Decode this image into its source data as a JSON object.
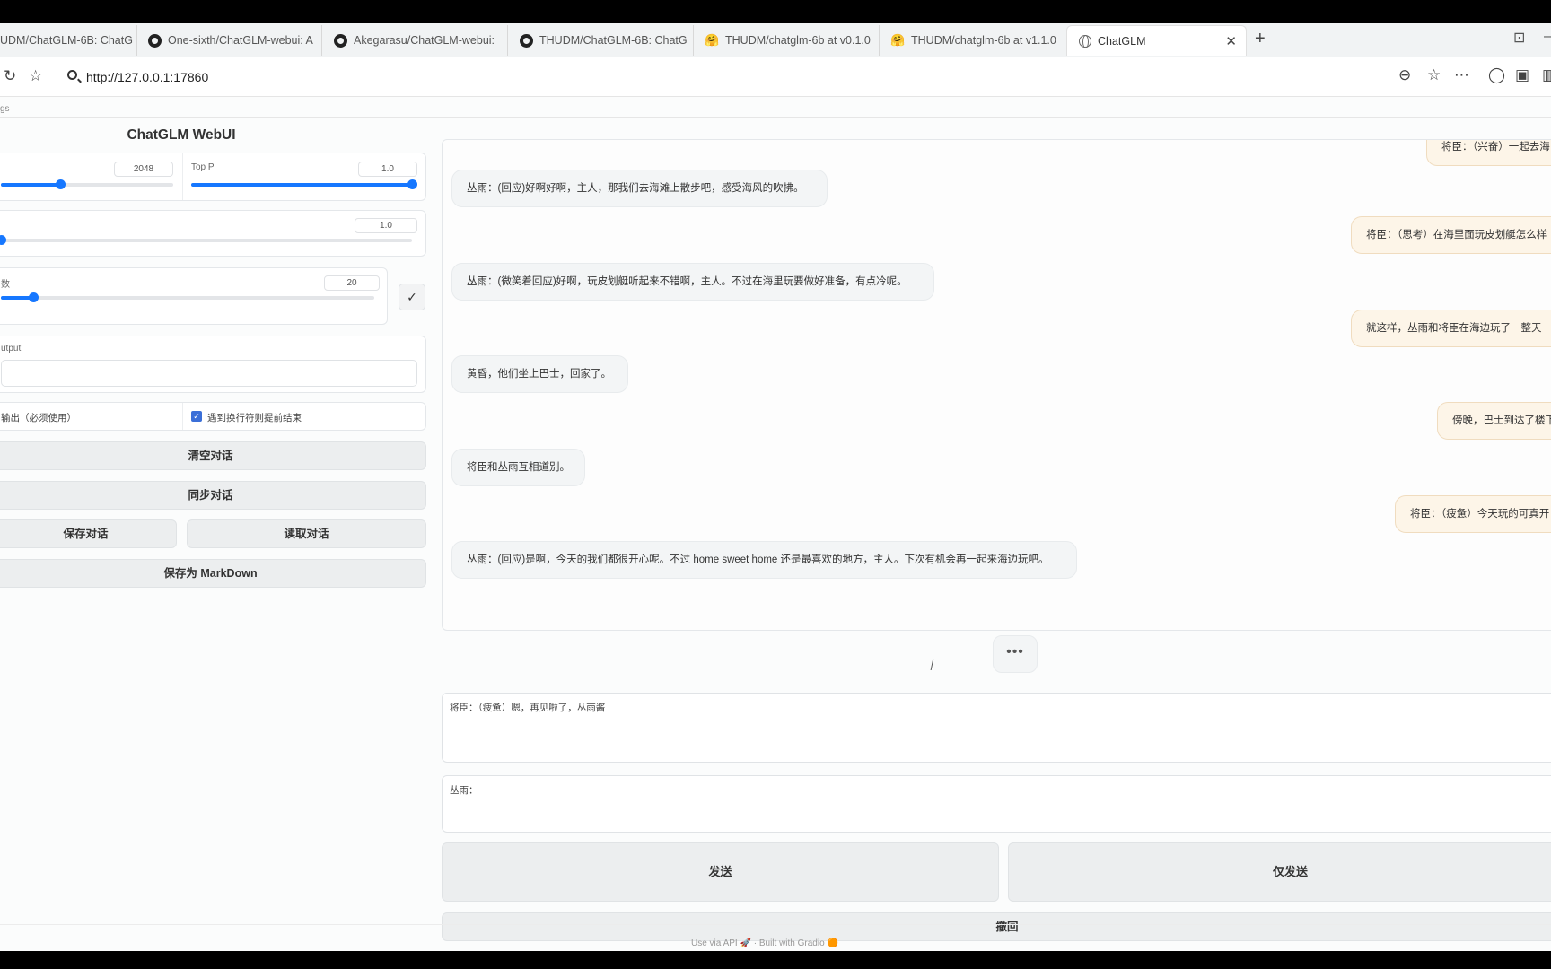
{
  "tabs": [
    {
      "title": "UDM/ChatGLM-6B: ChatG",
      "icon": "none",
      "active": false
    },
    {
      "title": "One-sixth/ChatGLM-webui: A",
      "icon": "github-icon",
      "active": false
    },
    {
      "title": "Akegarasu/ChatGLM-webui:",
      "icon": "github-icon",
      "active": false
    },
    {
      "title": "THUDM/ChatGLM-6B: ChatG",
      "icon": "github-icon",
      "active": false
    },
    {
      "title": "THUDM/chatglm-6b at v0.1.0",
      "icon": "huggingface-icon",
      "active": false
    },
    {
      "title": "THUDM/chatglm-6b at v1.1.0",
      "icon": "huggingface-icon",
      "active": false
    },
    {
      "title": "ChatGLM",
      "icon": "globe-icon",
      "active": true
    }
  ],
  "address": {
    "url": "http://127.0.0.1:17860"
  },
  "page": {
    "tabs_label": "gs"
  },
  "left": {
    "title": "ChatGLM WebUI",
    "max_length_value": "2048",
    "top_p_label": "Top P",
    "top_p_value": "1.0",
    "temperature_value": "1.0",
    "history_label": "数",
    "history_value": "20",
    "check_symbol": "✓",
    "output_label": "utput",
    "option_stream": "输出（必须使用）",
    "option_newline": "遇到换行符则提前结束",
    "clear_btn": "清空对话",
    "sync_btn": "同步对话",
    "save_btn": "保存对话",
    "load_btn": "读取对话",
    "save_md_btn": "保存为 MarkDown"
  },
  "chat": {
    "messages": [
      {
        "role": "user",
        "text": "将臣：（兴奋）一起去海"
      },
      {
        "role": "bot",
        "text": "丛雨：(回应)好啊好啊，主人，那我们去海滩上散步吧，感受海风的吹拂。"
      },
      {
        "role": "user",
        "text": "将臣：（思考）在海里面玩皮划艇怎么样"
      },
      {
        "role": "bot",
        "text": "丛雨：(微笑着回应)好啊，玩皮划艇听起来不错啊，主人。不过在海里玩要做好准备，有点冷呢。"
      },
      {
        "role": "user",
        "text": "就这样，丛雨和将臣在海边玩了一整天"
      },
      {
        "role": "bot",
        "text": "黄昏，他们坐上巴士，回家了。"
      },
      {
        "role": "user",
        "text": "傍晚，巴士到达了楼下"
      },
      {
        "role": "bot",
        "text": "将臣和丛雨互相道别。"
      },
      {
        "role": "user",
        "text": "将臣：（疲惫）今天玩的可真开"
      },
      {
        "role": "bot",
        "text": "丛雨：(回应)是啊，今天的我们都很开心呢。不过 home sweet home 还是最喜欢的地方，主人。下次有机会再一起来海边玩吧。"
      }
    ],
    "typing": "•••"
  },
  "input": {
    "user_text": "将臣：（疲惫）嗯，再见啦了，丛雨酱",
    "bot_prefix": "丛雨："
  },
  "buttons": {
    "send": "发送",
    "send_only": "仅发送",
    "undo": "撤回"
  },
  "footer": {
    "api": "Use via API",
    "sep": "·",
    "built": "Built with Gradio"
  },
  "colors": {
    "accent": "#1677ff",
    "user_bubble": "#fdf5e8",
    "bot_bubble": "#f3f5f6"
  }
}
